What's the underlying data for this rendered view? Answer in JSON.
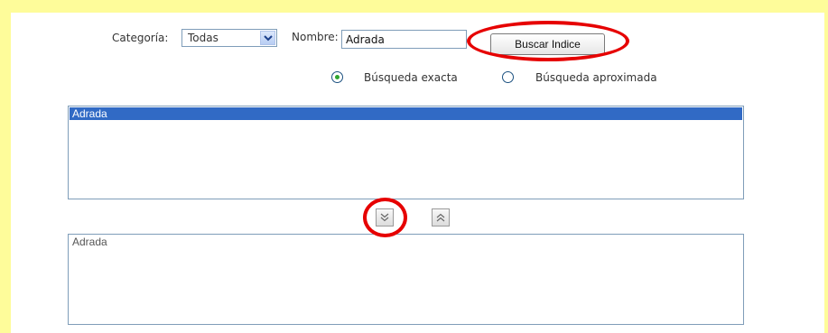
{
  "form": {
    "category_label": "Categoría:",
    "category_value": "Todas",
    "name_label": "Nombre:",
    "name_value": "Adrada",
    "search_button": "Buscar Indice"
  },
  "search_mode": {
    "exact_label": "Búsqueda exacta",
    "approx_label": "Búsqueda aproximada",
    "selected": "exact"
  },
  "results_list": {
    "items": [
      "Adrada"
    ],
    "selected_index": 0
  },
  "selected_list": {
    "items": [
      "Adrada"
    ]
  },
  "icons": {
    "dropdown": "chevron-down-icon",
    "move_down": "double-chevron-down-icon",
    "move_up": "double-chevron-up-icon"
  },
  "colors": {
    "frame": "#fefc9a",
    "highlight_ring": "#e60000",
    "selection": "#316ac5",
    "radio_dot": "#2ea52e"
  }
}
